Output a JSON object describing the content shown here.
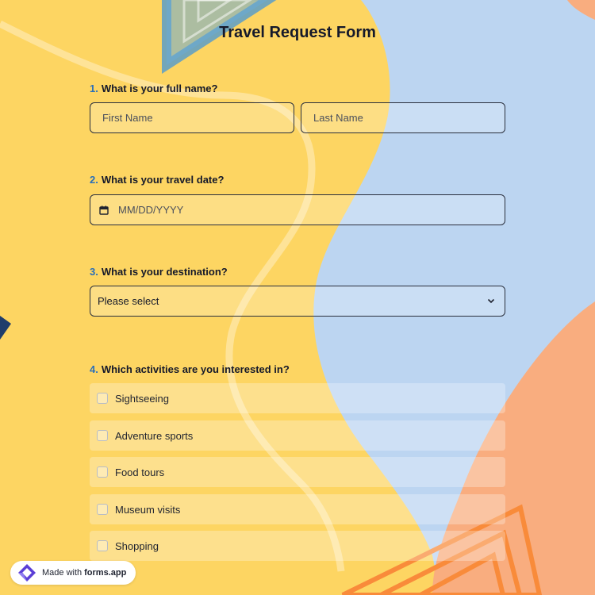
{
  "form": {
    "title": "Travel Request Form"
  },
  "questions": [
    {
      "num": "1.",
      "label": "What is your full name?"
    },
    {
      "num": "2.",
      "label": "What is your travel date?"
    },
    {
      "num": "3.",
      "label": "What is your destination?"
    },
    {
      "num": "4.",
      "label": "Which activities are you interested in?"
    }
  ],
  "name_fields": {
    "first_placeholder": "First Name",
    "last_placeholder": "Last Name"
  },
  "date_field": {
    "placeholder": "MM/DD/YYYY",
    "icon": "calendar-icon"
  },
  "destination_select": {
    "selected": "Please select",
    "icon": "chevron-down-icon"
  },
  "activities": [
    {
      "label": "Sightseeing",
      "checked": false
    },
    {
      "label": "Adventure sports",
      "checked": false
    },
    {
      "label": "Food tours",
      "checked": false
    },
    {
      "label": "Museum visits",
      "checked": false
    },
    {
      "label": "Shopping",
      "checked": false
    }
  ],
  "badge": {
    "prefix": "Made with",
    "brand": "forms.app",
    "icon": "forms-app-logo-icon"
  },
  "colors": {
    "yellow": "#fdd562",
    "blue": "#bcd5f1",
    "orange": "#f9ad7f",
    "accent_number": "#2a6fb8"
  }
}
